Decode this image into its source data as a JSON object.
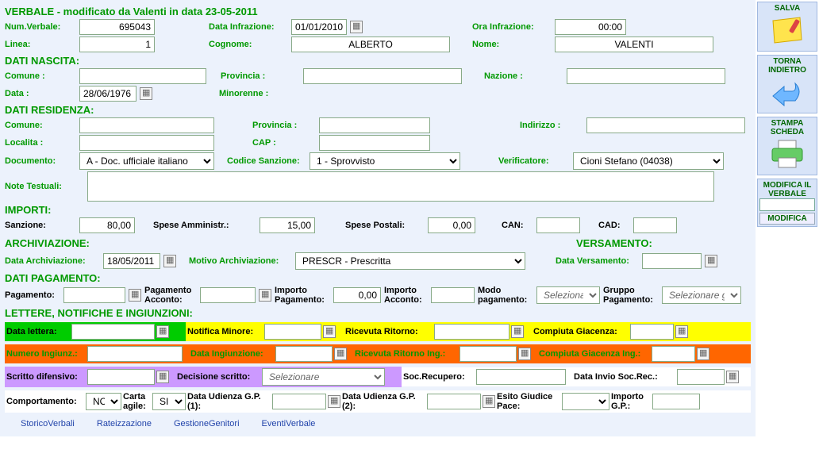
{
  "header": {
    "title": "VERBALE - modificato da Valenti in data 23-05-2011"
  },
  "verbale": {
    "numLbl": "Num.Verbale:",
    "num": "695043",
    "dataInfLbl": "Data Infrazione:",
    "dataInf": "01/01/2010",
    "oraInfLbl": "Ora Infrazione:",
    "oraInf": "00:00",
    "lineaLbl": "Linea:",
    "linea": "1",
    "cognomeLbl": "Cognome:",
    "cognome": "ALBERTO",
    "nomeLbl": "Nome:",
    "nome": "VALENTI"
  },
  "nascita": {
    "title": "DATI NASCITA:",
    "comuneLbl": "Comune :",
    "comune": "",
    "provLbl": "Provincia :",
    "prov": "",
    "nazLbl": "Nazione :",
    "naz": "",
    "dataLbl": "Data :",
    "data": "28/06/1976",
    "minLbl": "Minorenne :",
    "min": ""
  },
  "residenza": {
    "title": "DATI RESIDENZA:",
    "comuneLbl": "Comune:",
    "comune": "",
    "provLbl": "Provincia :",
    "prov": "",
    "indLbl": "Indirizzo :",
    "ind": "",
    "locLbl": "Localita :",
    "loc": "",
    "capLbl": "CAP :",
    "cap": "",
    "docLbl": "Documento:",
    "doc": "A - Doc. ufficiale italiano",
    "csLbl": "Codice Sanzione:",
    "cs": "1 - Sprovvisto",
    "verLbl": "Verificatore:",
    "ver": "Cioni Stefano (04038)",
    "noteLbl": "Note Testuali:",
    "note": ""
  },
  "importi": {
    "title": "IMPORTI:",
    "sanzLbl": "Sanzione:",
    "sanz": "80,00",
    "spAmmLbl": "Spese Amministr.:",
    "spAmm": "15,00",
    "spPostLbl": "Spese Postali:",
    "spPost": "0,00",
    "canLbl": "CAN:",
    "can": "",
    "cadLbl": "CAD:",
    "cad": ""
  },
  "arch": {
    "title": "ARCHIVIAZIONE:",
    "dataLbl": "Data Archiviazione:",
    "data": "18/05/2011",
    "motLbl": "Motivo Archiviazione:",
    "mot": "PRESCR - Prescritta"
  },
  "vers": {
    "title": "VERSAMENTO:",
    "dataLbl": "Data Versamento:",
    "data": ""
  },
  "pag": {
    "title": "DATI PAGAMENTO:",
    "pagLbl": "Pagamento:",
    "pag": "",
    "accLbl": "Pagamento Acconto:",
    "acc": "",
    "impLbl": "Importo Pagamento:",
    "imp": "0,00",
    "iaccLbl": "Importo Acconto:",
    "iacc": "",
    "modoLbl": "Modo pagamento:",
    "modo": "Selezionare",
    "grpLbl": "Gruppo Pagamento:",
    "grp": "Selezionare gru"
  },
  "lettere": {
    "title": "LETTERE, NOTIFICHE E INGIUNZIONI:",
    "g": {
      "dataLbl": "Data lettera:"
    },
    "y": {
      "notMinLbl": "Notifica Minore:",
      "ricLbl": "Ricevuta Ritorno:",
      "cgLbl": "Compiuta Giacenza:"
    },
    "o": {
      "numLbl": "Numero Ingiunz.:",
      "dataLbl": "Data Ingiunzione:",
      "ricLbl": "Ricevuta Ritorno Ing.:",
      "cgLbl": "Compiuta Giacenza Ing.:"
    },
    "p": {
      "scrLbl": "Scritto difensivo:",
      "decLbl": "Decisione scritto:",
      "dec": "Selezionare",
      "socLbl": "Soc.Recupero:",
      "invLbl": "Data Invio Soc.Rec.:"
    },
    "w": {
      "compLbl": "Comportamento:",
      "comp": "NO",
      "cartaLbl": "Carta agile:",
      "carta": "SI",
      "du1Lbl": "Data Udienza G.P.(1):",
      "du2Lbl": "Data Udienza G.P.(2):",
      "esitoLbl": "Esito Giudice Pace:",
      "impLbl": "Importo G.P.:"
    }
  },
  "footer": {
    "l1": "StoricoVerbali",
    "l2": "Rateizzazione",
    "l3": "GestioneGenitori",
    "l4": "EventiVerbale"
  },
  "side": {
    "salva": "SALVA",
    "torna": "TORNA INDIETRO",
    "stampa": "STAMPA SCHEDA",
    "modv": "MODIFICA IL VERBALE",
    "modBtn": "MODIFICA"
  }
}
